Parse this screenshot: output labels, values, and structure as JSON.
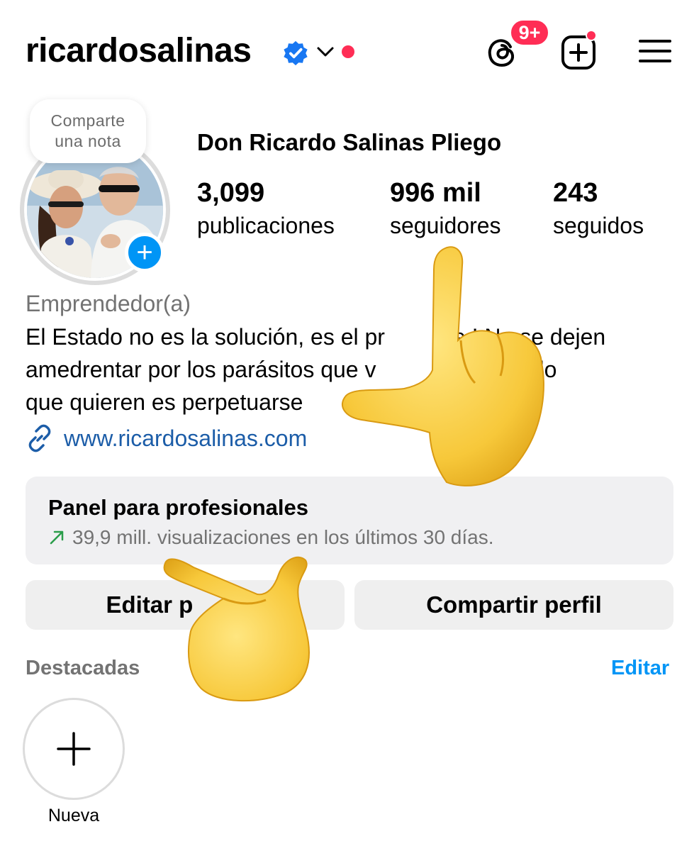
{
  "header": {
    "username": "ricardosalinas",
    "notification_badge": "9+",
    "accent_red": "#ff2d55",
    "verified_color": "#1877f2"
  },
  "profile": {
    "note_prompt_line1": "Comparte",
    "note_prompt_line2": "una nota",
    "full_name": "Don Ricardo Salinas Pliego",
    "stats": [
      {
        "value": "3,099",
        "label": "publicaciones"
      },
      {
        "value": "996 mil",
        "label": "seguidores"
      },
      {
        "value": "243",
        "label": "seguidos"
      }
    ],
    "category": "Emprendedor(a)",
    "bio_lines": [
      "El Estado no es la solución, es el pr",
      "e ! No se dejen",
      "amedrentar por los parásitos que v",
      "tado, lo",
      "que quieren es perpetuarse"
    ],
    "website": "www.ricardosalinas.com",
    "link_color": "#1c5da8"
  },
  "pro_panel": {
    "title": "Panel para profesionales",
    "subtitle": "39,9 mill. visualizaciones en los últimos 30 días.",
    "trend_icon": "trend-up-arrow"
  },
  "actions": {
    "edit_label_part1": "Editar p",
    "edit_label_part2": "rfil",
    "share_label": "Compartir perfil"
  },
  "highlights": {
    "title": "Destacadas",
    "edit_label": "Editar",
    "new_label": "Nueva",
    "accent_blue": "#0095f6"
  },
  "overlays": {
    "emoji": [
      "pointing-hand-emoji",
      "pointing-hand-emoji"
    ]
  }
}
